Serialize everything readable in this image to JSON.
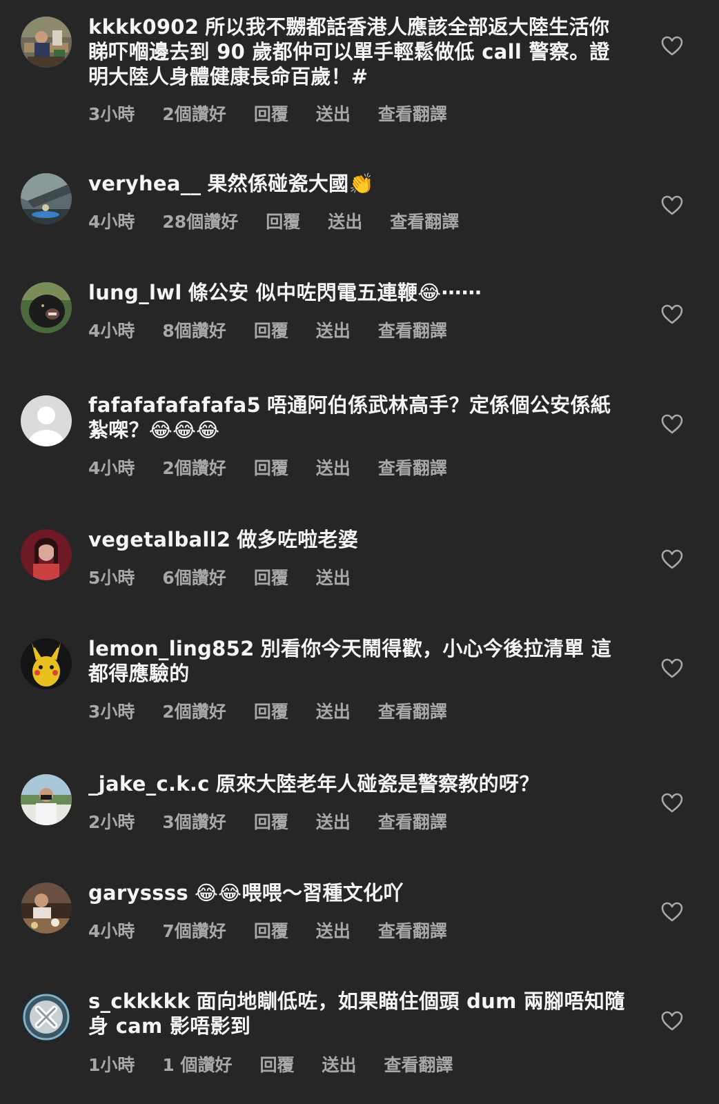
{
  "comments": [
    {
      "user": "kkkk0902",
      "text": "所以我不嬲都話香港人應該全部返大陸生活你睇吓嗰邊去到 90 歲都仲可以單手輕鬆做低 call 警察。證明大陸人身體健康長命百歲！#",
      "time": "3小時",
      "likes": "2個讚好",
      "reply": "回覆",
      "send": "送出",
      "translate": "查看翻譯",
      "avatar": "avatar-photo-man-desk"
    },
    {
      "user": "veryhea__",
      "text": "果然係碰瓷大國👏",
      "time": "4小時",
      "likes": "28個讚好",
      "reply": "回覆",
      "send": "送出",
      "translate": "查看翻譯",
      "avatar": "avatar-photo-kayak"
    },
    {
      "user": "lung_lwl",
      "text": "條公安 似中咗閃電五連鞭😂⋯⋯",
      "time": "4小時",
      "likes": "8個讚好",
      "reply": "回覆",
      "send": "送出",
      "translate": "查看翻譯",
      "avatar": "avatar-photo-gorilla"
    },
    {
      "user": "fafafafafafafa5",
      "text": "唔通阿伯係武林高手？定係個公安係紙紮㗎？😂😂😂",
      "time": "4小時",
      "likes": "2個讚好",
      "reply": "回覆",
      "send": "送出",
      "translate": "查看翻譯",
      "avatar": "avatar-default-person"
    },
    {
      "user": "vegetalball2",
      "text": "做多咗啦老婆",
      "time": "5小時",
      "likes": "6個讚好",
      "reply": "回覆",
      "send": "送出",
      "translate": "",
      "avatar": "avatar-photo-woman-red"
    },
    {
      "user": "lemon_ling852",
      "text": "別看你今天鬧得歡，小心今後拉清單 這都得應驗的",
      "time": "3小時",
      "likes": "2個讚好",
      "reply": "回覆",
      "send": "送出",
      "translate": "查看翻譯",
      "avatar": "avatar-pikachu"
    },
    {
      "user": "_jake_c.k.c",
      "text": "原來大陸老年人碰瓷是警察教的呀？",
      "time": "2小時",
      "likes": "3個讚好",
      "reply": "回覆",
      "send": "送出",
      "translate": "查看翻譯",
      "avatar": "avatar-photo-man-mask"
    },
    {
      "user": "garyssss",
      "text": "😂😂喂喂～習種文化吖",
      "time": "4小時",
      "likes": "7個讚好",
      "reply": "回覆",
      "send": "送出",
      "translate": "查看翻譯",
      "avatar": "avatar-photo-dinner"
    },
    {
      "user": "s_ckkkkk",
      "text": "面向地瞓低咗，如果瞄住個頭 dum 兩腳唔知隨身 cam 影唔影到",
      "time": "1小時",
      "likes": "1 個讚好",
      "reply": "回覆",
      "send": "送出",
      "translate": "查看翻譯",
      "avatar": "avatar-x-logo"
    }
  ],
  "colors": {
    "background": "#262626",
    "text": "#f5f5f5",
    "meta": "#a8a8a8"
  },
  "icons": {
    "like": "heart-outline-icon"
  }
}
